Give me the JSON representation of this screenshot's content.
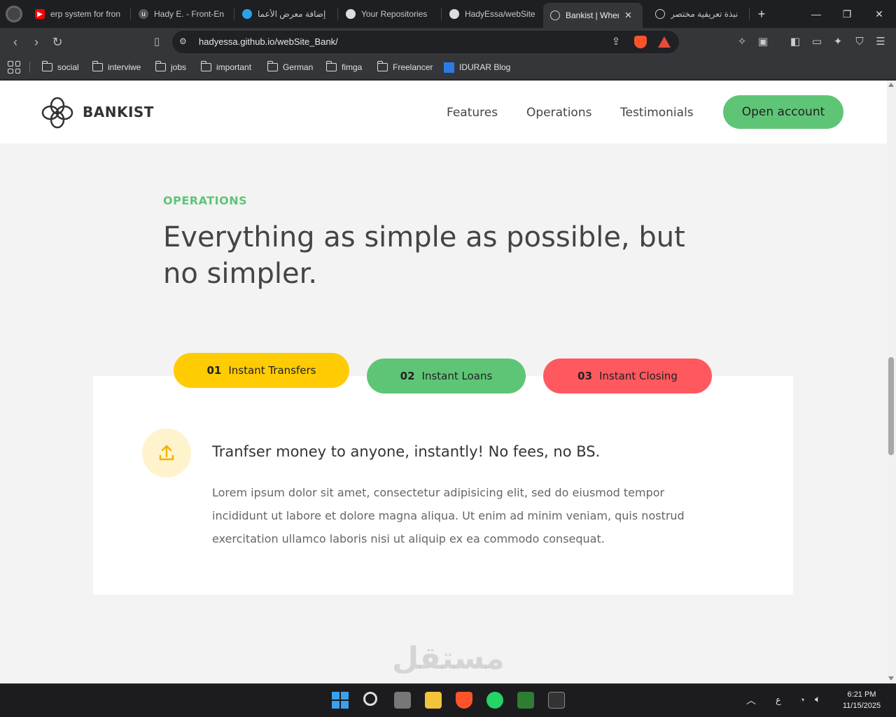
{
  "browser": {
    "tabs": [
      {
        "title": "erp system for fron",
        "icon": "youtube-icon",
        "color": "#ff0000"
      },
      {
        "title": "Hady E. - Front-En",
        "icon": "upwork-icon",
        "color": "#555555"
      },
      {
        "title": "إضافة معرض الأعما",
        "icon": "mostaql-icon",
        "color": "#2aa2e6"
      },
      {
        "title": "Your Repositories",
        "icon": "github-icon",
        "color": "#dddddd"
      },
      {
        "title": "HadyEssa/webSite",
        "icon": "github-icon",
        "color": "#dddddd"
      },
      {
        "title": "Bankist | When",
        "icon": "bankist-icon",
        "color": "#cccccc"
      },
      {
        "title": "نبذة تعريفية مختصر",
        "icon": "chatgpt-icon",
        "color": "#cccccc"
      }
    ],
    "new_tab": "+",
    "url": "hadyessa.github.io/webSite_Bank/",
    "bookmarks": [
      "social",
      "interviwe",
      "jobs",
      "important",
      "German",
      "fimga",
      "Freelancer",
      "IDURAR Blog"
    ]
  },
  "site": {
    "logo": "BANKIST",
    "nav": [
      "Features",
      "Operations",
      "Testimonials"
    ],
    "cta": "Open account",
    "section_label": "OPERATIONS",
    "section_title": "Everything as simple as possible, but no simpler.",
    "tabs": [
      {
        "num": "01",
        "label": "Instant Transfers",
        "color": "#ffcb03"
      },
      {
        "num": "02",
        "label": "Instant Loans",
        "color": "#5ec576"
      },
      {
        "num": "03",
        "label": "Instant Closing",
        "color": "#ff585f"
      }
    ],
    "content_title": "Tranfser money to anyone, instantly! No fees, no BS.",
    "content_body": "Lorem ipsum dolor sit amet, consectetur adipisicing elit, sed do eiusmod tempor incididunt ut labore et dolore magna aliqua. Ut enim ad minim veniam, quis nostrud exercitation ullamco laboris nisi ut aliquip ex ea commodo consequat."
  },
  "watermark": "مستقل",
  "taskbar": {
    "time": "6:21 PM",
    "date": "11/15/2025",
    "lang": "ع"
  }
}
